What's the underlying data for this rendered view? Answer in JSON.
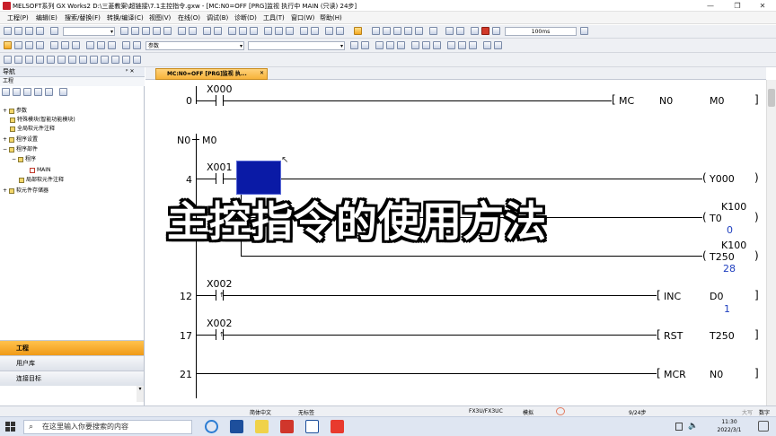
{
  "window": {
    "title": "MELSOFT系列 GX Works2 D:\\三菱教案\\超链接\\7.1主控指令.gxw - [MC:N0=OFF [PRG]监视 执行中 MAIN (只读) 24步]",
    "min": "—",
    "max": "❐",
    "close": "✕"
  },
  "menu": [
    "工程(P)",
    "编辑(E)",
    "搜索/替换(F)",
    "转换/编译(C)",
    "视图(V)",
    "在线(O)",
    "调试(B)",
    "诊断(D)",
    "工具(T)",
    "窗口(W)",
    "帮助(H)"
  ],
  "toolbar": {
    "scan_time": "100ms",
    "parameter_combo": "参数"
  },
  "nav": {
    "title": "导航",
    "pin": "ᵖ ✕",
    "section": "工程",
    "tree": [
      {
        "label": "参数",
        "indent": 0,
        "expander": "+"
      },
      {
        "label": "特殊模块(智能功能模块)",
        "indent": 1,
        "expander": ""
      },
      {
        "label": "全局软元件注释",
        "indent": 1,
        "expander": ""
      },
      {
        "label": "程序设置",
        "indent": 0,
        "expander": "+"
      },
      {
        "label": "程序部件",
        "indent": 0,
        "expander": "−"
      },
      {
        "label": "程序",
        "indent": 1,
        "expander": "−"
      },
      {
        "label": "MAIN",
        "indent": 2,
        "expander": ""
      },
      {
        "label": "局部软元件注释",
        "indent": 1,
        "expander": ""
      },
      {
        "label": "软元件存储器",
        "indent": 0,
        "expander": "+"
      }
    ],
    "tabs": [
      "工程",
      "用户库",
      "连接目标"
    ]
  },
  "editor": {
    "doc_tab": "MC:N0=OFF [PRG]监视 执...",
    "rungs": {
      "r0": {
        "step": "0",
        "contact": "X000",
        "instr": "MC",
        "op1": "N0",
        "op2": "M0"
      },
      "nest": {
        "n": "N0",
        "m": "M0"
      },
      "r4": {
        "step": "4",
        "contact": "X001",
        "coil1": "Y000",
        "t0_label": "T0",
        "t0_k": "K100",
        "t0_val": "0",
        "t250_label": "T250",
        "t250_k": "K100",
        "t250_val": "28"
      },
      "r12": {
        "step": "12",
        "contact": "X002",
        "instr": "INC",
        "op1": "D0",
        "op1_val": "1"
      },
      "r17": {
        "step": "17",
        "contact": "X002",
        "instr": "RST",
        "op1": "T250"
      },
      "r21": {
        "step": "21",
        "instr": "MCR",
        "op1": "N0"
      }
    }
  },
  "overlay_title": "主控指令的使用方法",
  "status": {
    "lang": "简体中文",
    "label": "无标签",
    "cpu": "FX3U/FX3UC",
    "mode": "模拟",
    "steps": "9/24步",
    "caps": "大写",
    "num": "数字"
  },
  "taskbar": {
    "search_placeholder": "在这里输入你要搜索的内容",
    "time": "11:30",
    "date": "2022/3/1"
  },
  "colors": {
    "accent": "#f7a928",
    "monitor_value": "#1f3fbf",
    "cursor": "#0a1aa6"
  }
}
